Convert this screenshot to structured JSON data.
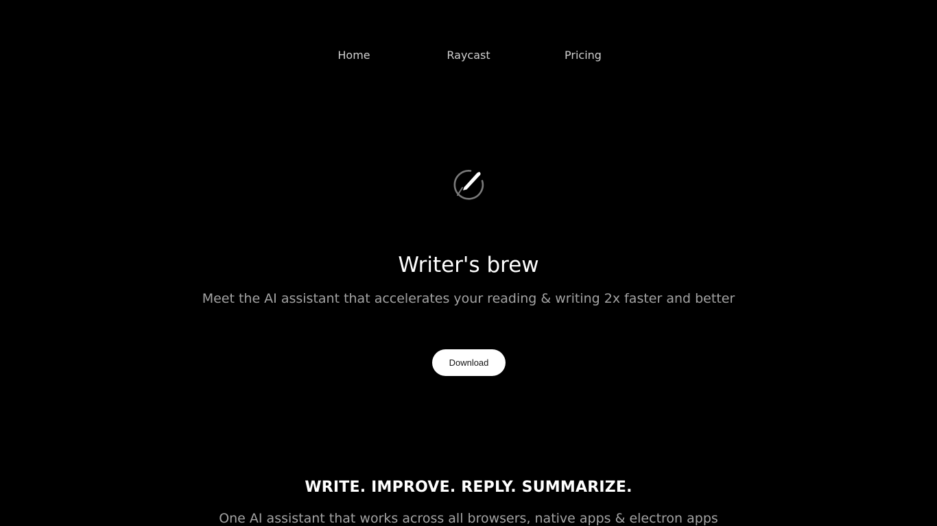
{
  "nav": {
    "items": [
      {
        "label": "Home"
      },
      {
        "label": "Raycast"
      },
      {
        "label": "Pricing"
      }
    ]
  },
  "hero": {
    "logo_icon": "pen-circle-icon",
    "title": "Writer's brew",
    "subtitle": "Meet the AI assistant that accelerates your reading & writing 2x faster and better",
    "download_label": "Download"
  },
  "features": {
    "tagline": "WRITE. IMPROVE. REPLY. SUMMARIZE.",
    "description": "One AI assistant that works across all browsers, native apps & electron apps"
  },
  "colors": {
    "background": "#000000",
    "title": "#ffffff",
    "muted_text": "#a3a3a3",
    "button_bg": "#ffffff",
    "button_text": "#111111"
  }
}
